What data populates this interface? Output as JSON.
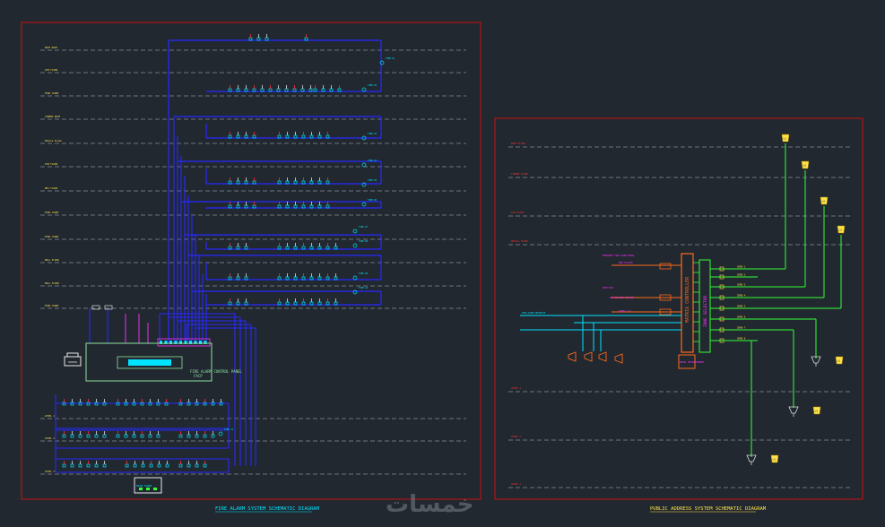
{
  "left_drawing": {
    "caption": "FIRE ALARM SYSTEM SCHEMATIC DIAGRAM",
    "floor_labels": [
      "ROOF ROOF",
      "GYM FLOOR",
      "FOOD COURT",
      "CINEMA ROOF",
      "Mobile Kiosk",
      "GYM FLOOR",
      "RES FLOOR",
      "FOOD COURT",
      "FOOD COURT",
      "MALL FLOOR",
      "MALL FLOOR",
      "FOOD COURT",
      "LEVEL 1",
      "LEVEL 2",
      "LEVEL 3"
    ],
    "riser_tags": [
      "FIRE-01",
      "FIRE-02",
      "FIRE-03",
      "FIRE-04",
      "FIRE-05",
      "FIRE-06",
      "FIRE-07",
      "FIRE-08",
      "FIRE-09",
      "FIRE-10",
      "FIRE-11"
    ],
    "panel_label": "FIRE ALARM CONTROL PANEL",
    "panel_sub": "FACP",
    "printer_label": "PRINTER",
    "bottom_box_label": "MAIN PANEL"
  },
  "right_drawing": {
    "caption": "PUBLIC ADDRESS SYSTEM SCHEMATIC DIAGRAM",
    "floor_labels": [
      "ROOF FLOOR",
      "CINEMA FLOOR",
      "GYM FLOOR",
      "RETAIL FLOOR",
      "LEVEL 1",
      "LEVEL 2",
      "LEVEL 3"
    ],
    "controller_label": "MATRIX CONTROLLER",
    "selector_label": "ZONE SELECTOR",
    "mic_label": "DESK MICROPHONE",
    "bgm_label": "BGM PLAYER",
    "zone_labels": [
      "ZONE-1",
      "ZONE-2",
      "ZONE-3",
      "ZONE-4",
      "ZONE-5",
      "ZONE-6",
      "ZONE-7",
      "ZONE-8"
    ],
    "input_notes": [
      "EMERGENCY FIRE ALARM SIGNAL",
      "FROM FACP",
      "PRE RECORDED MESSAGE",
      "TUNER / CD"
    ],
    "speaker_tags": [
      "LS",
      "LS",
      "LS",
      "LS",
      "LS",
      "LS",
      "LS"
    ]
  },
  "watermark": "خمسات",
  "colors": {
    "background": "#212830",
    "frame": "#cc1111",
    "wire_blue": "#2828ff",
    "cyan": "#00e5ff",
    "green": "#33ff33",
    "magenta": "#ff33ff",
    "orange": "#ff6a1a",
    "yellow": "#ffe24a",
    "grey": "#8a8f96"
  }
}
